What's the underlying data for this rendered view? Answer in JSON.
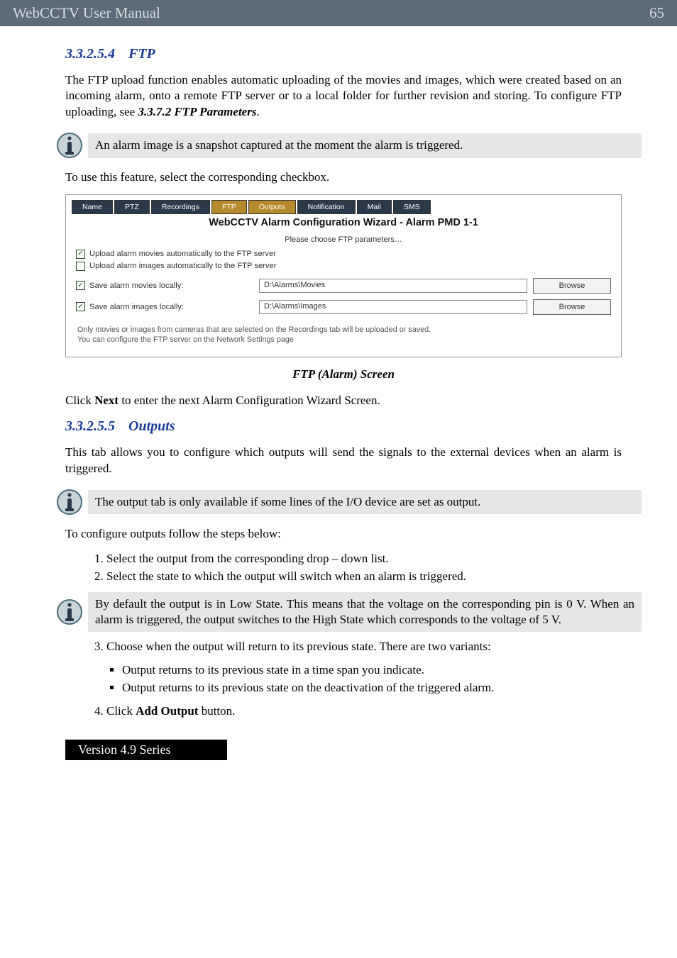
{
  "header": {
    "title": "WebCCTV User Manual",
    "page": "65"
  },
  "sec_ftp": {
    "num": "3.3.2.5.4",
    "title": "FTP"
  },
  "ftp_para": {
    "t1": "The FTP upload function enables automatic uploading of the movies and images, which were created based on an incoming alarm, onto a remote FTP server or to a local folder for further revision and storing. To configure FTP uploading, see ",
    "ref": "3.3.7.2 FTP Parameters",
    "t2": "."
  },
  "callout1": "An alarm image is a snapshot captured at the moment the alarm is triggered.",
  "para_feature": "To use this feature, select the corresponding checkbox.",
  "shot": {
    "tabs": {
      "name": "Name",
      "ptz": "PTZ",
      "recordings": "Recordings",
      "ftp": "FTP",
      "outputs": "Outputs",
      "notification": "Notification",
      "mail": "Mail",
      "sms": "SMS"
    },
    "wizTitle": "WebCCTV Alarm Configuration Wizard - Alarm PMD 1-1",
    "paramsLabel": "Please choose FTP parameters…",
    "cb_movies_auto": "Upload alarm movies automatically to the FTP server",
    "cb_images_auto": "Upload alarm images automatically to the FTP server",
    "save_movies_label": "Save alarm movies locally:",
    "save_movies_path": "D:\\Alarms\\Movies",
    "save_images_label": "Save alarm images locally:",
    "save_images_path": "D:\\Alarms\\Images",
    "browse": "Browse",
    "hint1": "Only movies or images from cameras that are selected on the Recordings tab will be uploaded or saved.",
    "hint2": "You can configure the FTP server on the Network Settings page"
  },
  "figcap": "FTP (Alarm) Screen",
  "para_next": {
    "t1": "Click ",
    "b": "Next",
    "t2": " to enter the next Alarm Configuration Wizard Screen."
  },
  "sec_outputs": {
    "num": "3.3.2.5.5",
    "title": "Outputs"
  },
  "outputs_para": "This tab allows you to configure which outputs will send the signals to the external devices when an alarm is triggered.",
  "callout2": "The output tab is only available if some lines of the I/O device are set as output.",
  "para_cfg": "To configure outputs follow the steps below:",
  "steps12": {
    "s1": "Select the output from the corresponding drop – down list.",
    "s2": "Select the state to which the output will switch when an alarm is triggered."
  },
  "callout3": "By default the output is in Low State. This means that the voltage on the corresponding pin is 0 V. When an alarm is triggered, the output switches to the High State which corresponds to the voltage of 5 V.",
  "step3": "Choose when the output will return to its previous state. There are two variants:",
  "bullets": {
    "b1": "Output returns to its previous state in a time span you indicate.",
    "b2": "Output returns to its previous state on the deactivation of the triggered alarm."
  },
  "step4": {
    "t1": "Click ",
    "b": "Add Output",
    "t2": " button."
  },
  "footer": "Version 4.9 Series"
}
